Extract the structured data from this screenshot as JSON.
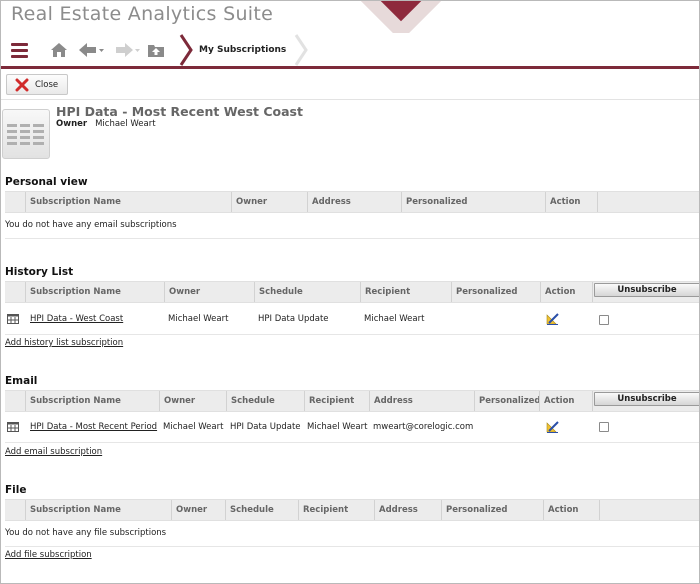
{
  "header": {
    "app_title": "Real Estate Analytics Suite",
    "breadcrumb": "My Subscriptions",
    "accent_color": "#7d2a3a"
  },
  "toolbar": {
    "close_label": "Close"
  },
  "report": {
    "title": "HPI Data - Most Recent West Coast",
    "owner_label": "Owner",
    "owner_value": "Michael Weart"
  },
  "personal_view": {
    "title": "Personal view",
    "columns": [
      "Subscription Name",
      "Owner",
      "Address",
      "Personalized",
      "Action"
    ],
    "empty_message": "You do not have any email subscriptions"
  },
  "history_list": {
    "title": "History List",
    "columns": [
      "Subscription Name",
      "Owner",
      "Schedule",
      "Recipient",
      "Personalized",
      "Action"
    ],
    "unsubscribe_label": "Unsubscribe",
    "rows": [
      {
        "name": "HPI Data - West Coast",
        "owner": "Michael Weart",
        "schedule": "HPI Data Update",
        "recipient": "Michael Weart",
        "personalized": ""
      }
    ],
    "add_link": "Add history list subscription"
  },
  "email": {
    "title": "Email",
    "columns": [
      "Subscription Name",
      "Owner",
      "Schedule",
      "Recipient",
      "Address",
      "Personalized",
      "Action"
    ],
    "unsubscribe_label": "Unsubscribe",
    "rows": [
      {
        "name": "HPI Data - Most Recent Period",
        "owner": "Michael Weart",
        "schedule": "HPI Data Update",
        "recipient": "Michael Weart",
        "address": "mweart@corelogic.com",
        "personalized": ""
      }
    ],
    "add_link": "Add email subscription"
  },
  "file": {
    "title": "File",
    "columns": [
      "Subscription Name",
      "Owner",
      "Schedule",
      "Recipient",
      "Address",
      "Personalized",
      "Action"
    ],
    "empty_message": "You do not have any file subscriptions",
    "add_link": "Add file subscription"
  }
}
